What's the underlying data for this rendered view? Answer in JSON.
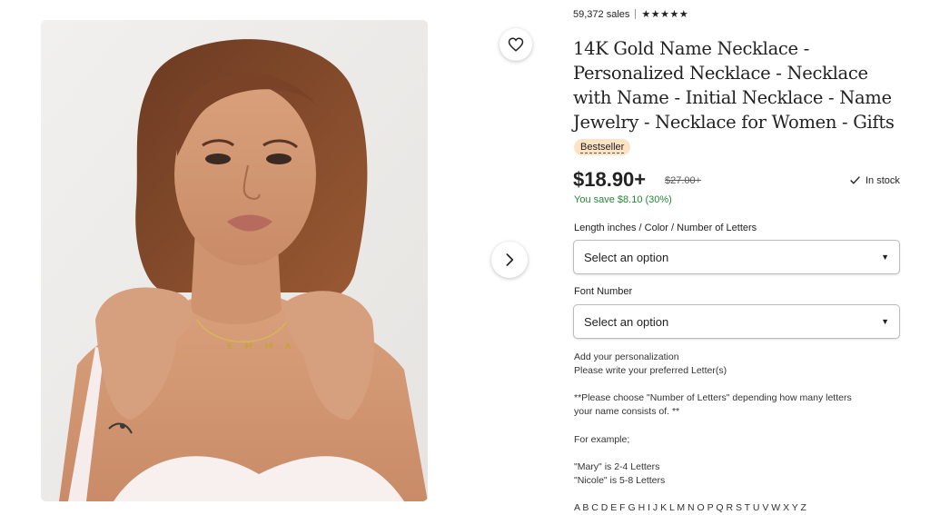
{
  "product": {
    "sales": "59,372 sales",
    "rating_stars": "★★★★★",
    "title": "14K Gold Name Necklace - Personalized Necklace - Necklace with Name - Initial Necklace - Name Jewelry - Necklace for Women - Gifts",
    "badge": "Bestseller",
    "price": "$18.90+",
    "original_price": "$27.00+",
    "stock": "In stock",
    "savings": "You save $8.10 (30%)"
  },
  "options": [
    {
      "label": "Length inches / Color / Number of Letters",
      "placeholder": "Select an option"
    },
    {
      "label": "Font Number",
      "placeholder": "Select an option"
    }
  ],
  "personalization": {
    "heading": "Add your personalization",
    "line1": "Please write your preferred Letter(s)",
    "note1": "**Please choose \"Number of Letters\" depending how many letters",
    "note2": "your name consists of. **",
    "example": "For example;",
    "ex1": "\"Mary\" is 2-4 Letters",
    "ex2": "\"Nicole\" is 5-8 Letters",
    "alphabet": "A B C D E F G H I J K L M N O P Q R S T U V W X Y Z"
  },
  "image": {
    "necklace_letters": "E M M A"
  },
  "icons": {
    "favorite": "heart-icon",
    "next": "chevron-right-icon",
    "stock": "check-icon",
    "dropdown": "caret-down-icon"
  },
  "colors": {
    "savings_green": "#258635",
    "badge_bg": "#fce3c4"
  }
}
